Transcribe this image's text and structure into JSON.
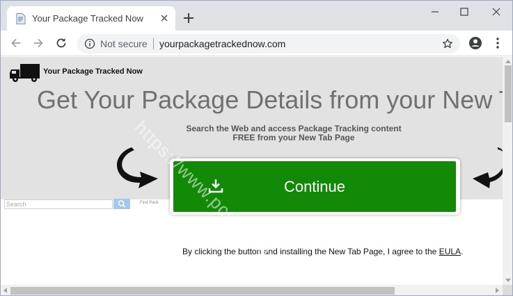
{
  "browser": {
    "tab_title": "Your Package Tracked Now",
    "omnibox": {
      "security_label": "Not secure",
      "url": "yourpackagetrackednow.com"
    }
  },
  "page": {
    "logo_text": "Your Package Tracked Now",
    "headline": "Get Your Package Details from your New T",
    "subline": "Search the Web and access Package Tracking content FREE from your New Tab Page",
    "search_placeholder": "Search",
    "find_text": "Find Pack",
    "cta_label": "Continue",
    "agreement_prefix": "By clicking the button and installing the New Tab Page, I agree to the ",
    "agreement_link": "EULA",
    "agreement_suffix": "."
  },
  "watermark": "https://www.pcrisk.com",
  "colors": {
    "cta_green": "#138a07",
    "hero_bg": "#e2e2e2",
    "headline_gray": "#707070"
  },
  "icons": [
    "page-icon",
    "close-icon",
    "plus-icon",
    "minimize-icon",
    "maximize-icon",
    "back-arrow-icon",
    "forward-arrow-icon",
    "reload-icon",
    "info-icon",
    "star-icon",
    "account-icon",
    "more-vert-icon",
    "truck-icon",
    "curved-arrow-icon",
    "download-icon",
    "search-icon"
  ]
}
